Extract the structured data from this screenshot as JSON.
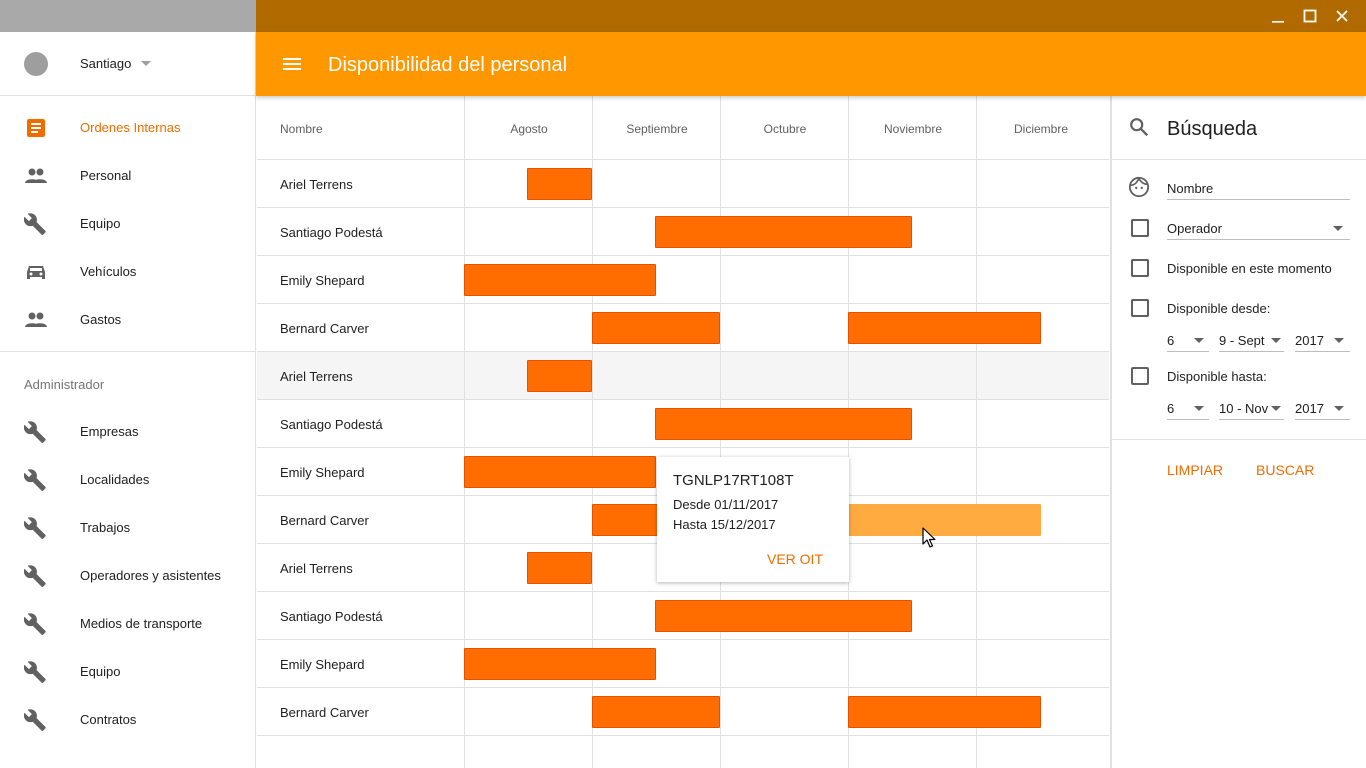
{
  "window": {
    "minimize_icon": "minimize-icon",
    "maximize_icon": "maximize-icon",
    "close_icon": "close-icon"
  },
  "user": {
    "name": "Santiago"
  },
  "sidebar": {
    "items": [
      {
        "label": "Ordenes Internas",
        "icon": "document-icon",
        "active": true
      },
      {
        "label": "Personal",
        "icon": "people-icon"
      },
      {
        "label": "Equipo",
        "icon": "wrench-icon"
      },
      {
        "label": "Vehículos",
        "icon": "car-icon"
      },
      {
        "label": "Gastos",
        "icon": "people-icon"
      }
    ],
    "section_title": "Administrador",
    "admin_items": [
      {
        "label": "Empresas",
        "icon": "wrench-icon"
      },
      {
        "label": "Localidades",
        "icon": "wrench-icon"
      },
      {
        "label": "Trabajos",
        "icon": "wrench-icon"
      },
      {
        "label": "Operadores y asistentes",
        "icon": "wrench-icon"
      },
      {
        "label": "Medios de transporte",
        "icon": "wrench-icon"
      },
      {
        "label": "Equipo",
        "icon": "wrench-icon"
      },
      {
        "label": "Contratos",
        "icon": "wrench-icon"
      }
    ]
  },
  "appbar": {
    "title": "Disponibilidad del personal"
  },
  "table": {
    "name_header": "Nombre",
    "months": [
      "Agosto",
      "Septiembre",
      "Octubre",
      "Noviembre",
      "Diciembre"
    ],
    "rows": [
      {
        "name": "Ariel Terrens"
      },
      {
        "name": "Santiago Podestá"
      },
      {
        "name": "Emily Shepard"
      },
      {
        "name": "Bernard Carver"
      },
      {
        "name": "Ariel Terrens",
        "highlighted": true
      },
      {
        "name": "Santiago Podestá"
      },
      {
        "name": "Emily Shepard"
      },
      {
        "name": "Bernard Carver"
      },
      {
        "name": "Ariel Terrens"
      },
      {
        "name": "Santiago Podestá"
      },
      {
        "name": "Emily Shepard"
      },
      {
        "name": "Bernard Carver"
      }
    ]
  },
  "popup": {
    "code": "TGNLP17RT108T",
    "from": "Desde 01/11/2017",
    "to": "Hasta 15/12/2017",
    "action": "VER OIT"
  },
  "search": {
    "title": "Búsqueda",
    "name_field": "Nombre",
    "role_select": "Operador",
    "available_now": "Disponible en este momento",
    "available_from": "Disponible desde:",
    "from_day": "6",
    "from_month": "9 - Sept",
    "from_year": "2017",
    "available_to": "Disponible hasta:",
    "to_day": "6",
    "to_month": "10 - Nov",
    "to_year": "2017",
    "clear_button": "LIMPIAR",
    "search_button": "BUSCAR"
  },
  "colors": {
    "accent": "#ff9800",
    "bar": "#ff6d00",
    "bar_hover": "#ffab40",
    "titlebar": "#b06a00"
  }
}
